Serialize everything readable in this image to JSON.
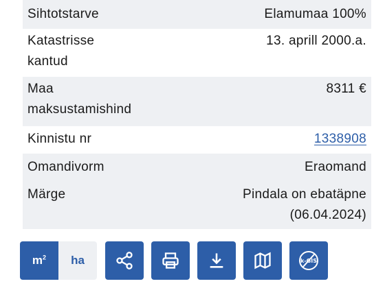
{
  "rows": [
    {
      "label": "Sihtotstarve",
      "value": "Elamumaa 100%"
    },
    {
      "label": "Katastrisse\nkantud",
      "value": "13. aprill 2000.a."
    },
    {
      "label": "Maa\nmaksustamishind",
      "value": "8311 €"
    },
    {
      "label": "Kinnistu nr",
      "value": "1338908"
    },
    {
      "label": "Omandivorm",
      "value": "Eraomand"
    },
    {
      "label": "Märge",
      "value": "Pindala on ebatäpne\n(06.04.2024)"
    }
  ],
  "toolbar": {
    "unit_m2": "m",
    "unit_m2_sup": "2",
    "unit_ha": "ha"
  },
  "colors": {
    "accent": "#2d5ea8",
    "row_alt": "#eef0f3"
  }
}
